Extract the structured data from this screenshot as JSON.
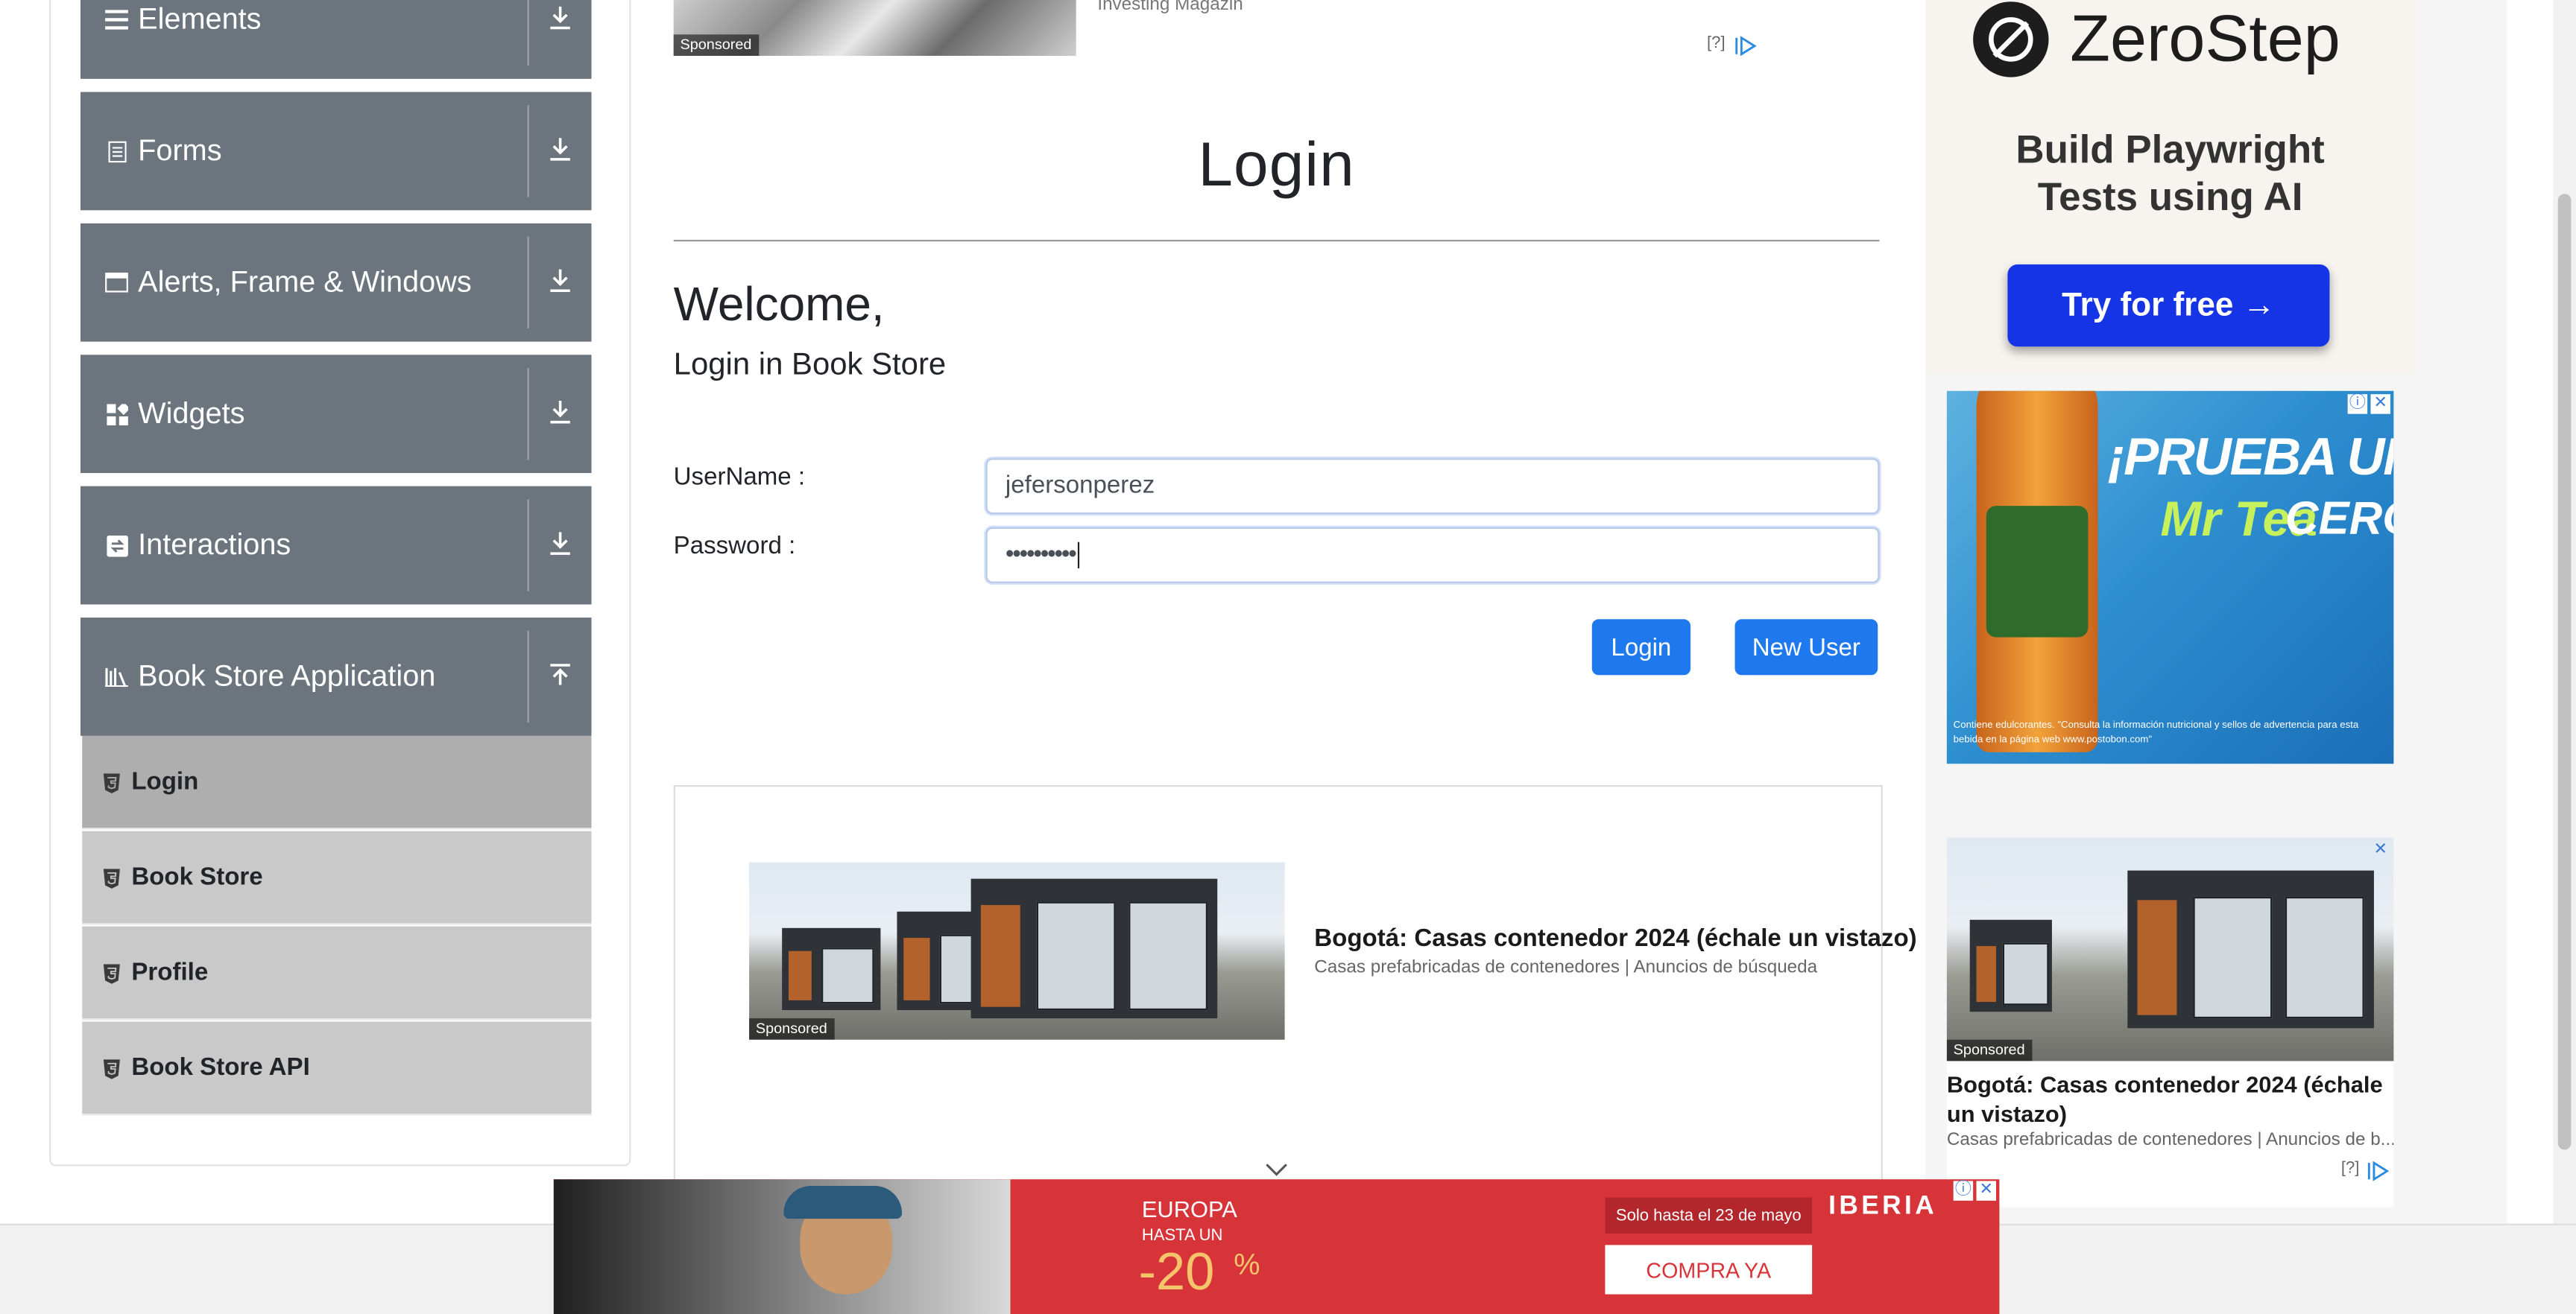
{
  "sidebar": {
    "groups": [
      {
        "label": "Elements",
        "icon": "hamburger-icon",
        "toggle": "download-arrow-icon"
      },
      {
        "label": "Forms",
        "icon": "document-icon",
        "toggle": "download-arrow-icon"
      },
      {
        "label": "Alerts, Frame & Windows",
        "icon": "window-icon",
        "toggle": "download-arrow-icon"
      },
      {
        "label": "Widgets",
        "icon": "widgets-icon",
        "toggle": "download-arrow-icon"
      },
      {
        "label": "Interactions",
        "icon": "interactions-icon",
        "toggle": "download-arrow-icon"
      },
      {
        "label": "Book Store Application",
        "icon": "books-icon",
        "toggle": "upload-arrow-icon"
      }
    ],
    "items": [
      {
        "label": "Login",
        "icon": "html5-icon",
        "active": true
      },
      {
        "label": "Book Store",
        "icon": "html5-icon",
        "active": false
      },
      {
        "label": "Profile",
        "icon": "html5-icon",
        "active": false
      },
      {
        "label": "Book Store API",
        "icon": "html5-icon",
        "active": false
      }
    ],
    "header_color": "#6c757d",
    "item_color": "#c9c9c9",
    "active_item_color": "#aeaeae"
  },
  "top_ad": {
    "sponsored": "Sponsored",
    "source": "Investing Magazin",
    "info": "[?]"
  },
  "main": {
    "title": "Login",
    "welcome": "Welcome,",
    "subtitle": "Login in Book Store",
    "username_label": "UserName :",
    "username_value": "jefersonperez",
    "password_label": "Password :",
    "password_value": "••••••••••",
    "login_button": "Login",
    "new_user_button": "New User",
    "accent_color": "#1e79ef"
  },
  "center_ad": {
    "sponsored": "Sponsored",
    "headline": "Bogotá: Casas contenedor 2024 (échale un vistazo)",
    "source": "Casas prefabricadas de contenedores | Anuncios de búsqueda"
  },
  "right_ads": {
    "zerostep_brand": "ZeroStep",
    "zerostep_tagline_1": "Build Playwright",
    "zerostep_tagline_2": "Tests using AI",
    "zerostep_cta": "Try for free →",
    "tea_headline_1": "¡PRUEBA UN",
    "tea_headline_2": "CERO",
    "tea_brand": "Mr Tea",
    "tea_disclaimer": "Contiene edulcorantes. \"Consulta la información nutricional y sellos de advertencia para esta bebida en la página web www.postobon.com\"",
    "house_sponsored": "Sponsored",
    "house_headline": "Bogotá: Casas contenedor 2024 (échale un vistazo)",
    "house_source": "Casas prefabricadas de contenedores | Anuncios de b...",
    "info": "[?]"
  },
  "bottom_ad": {
    "destination": "EUROPA",
    "hasta": "HASTA UN",
    "discount": "-20",
    "percent": "%",
    "promo": "Solo hasta el 23 de mayo",
    "brand": "IBERIA",
    "cta": "COMPRA YA"
  }
}
